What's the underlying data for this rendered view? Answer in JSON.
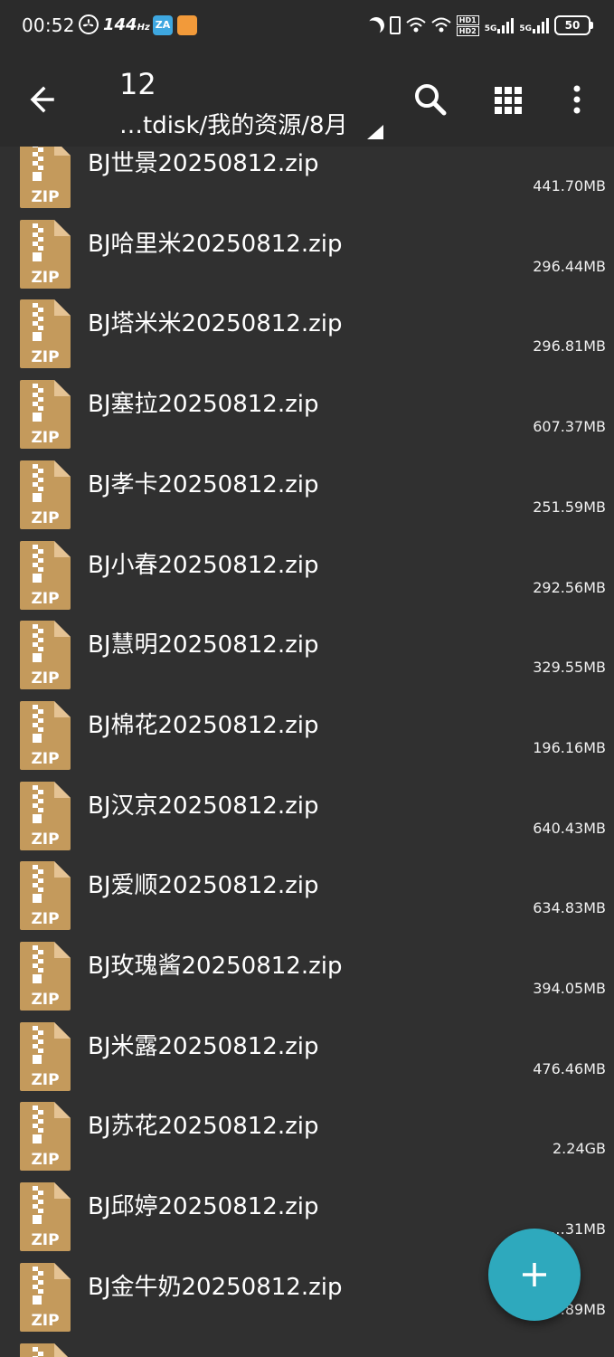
{
  "status_bar": {
    "time": "00:52",
    "refresh_rate": "144",
    "refresh_unit": "Hz",
    "app_badge": "ZA",
    "network_5g_1": "5G",
    "network_5g_2": "5G",
    "hd_label_1": "HD1",
    "hd_label_2": "HD2",
    "battery": "50"
  },
  "toolbar": {
    "title": "12",
    "path": "…tdisk/我的资源/8月"
  },
  "files": [
    {
      "name": "BJ世景20250812.zip",
      "size": "441.70MB"
    },
    {
      "name": "BJ哈里米20250812.zip",
      "size": "296.44MB"
    },
    {
      "name": "BJ塔米米20250812.zip",
      "size": "296.81MB"
    },
    {
      "name": "BJ塞拉20250812.zip",
      "size": "607.37MB"
    },
    {
      "name": "BJ孝卡20250812.zip",
      "size": "251.59MB"
    },
    {
      "name": "BJ小春20250812.zip",
      "size": "292.56MB"
    },
    {
      "name": "BJ慧明20250812.zip",
      "size": "329.55MB"
    },
    {
      "name": "BJ棉花20250812.zip",
      "size": "196.16MB"
    },
    {
      "name": "BJ汉京20250812.zip",
      "size": "640.43MB"
    },
    {
      "name": "BJ爱顺20250812.zip",
      "size": "634.83MB"
    },
    {
      "name": "BJ玫瑰酱20250812.zip",
      "size": "394.05MB"
    },
    {
      "name": "BJ米露20250812.zip",
      "size": "476.46MB"
    },
    {
      "name": "BJ苏花20250812.zip",
      "size": "2.24GB"
    },
    {
      "name": "BJ邱婷20250812.zip",
      "size": "…31MB"
    },
    {
      "name": "BJ金牛奶20250812.zip",
      "size": "606.89MB"
    },
    {
      "name": "",
      "size": ""
    }
  ],
  "icon_label": "ZIP",
  "colors": {
    "background": "#303030",
    "toolbar": "#2b2b2b",
    "zip_icon": "#c49a5c",
    "fab": "#2ea9bd"
  },
  "icons": {
    "back": "arrow-left-icon",
    "search": "search-icon",
    "grid": "grid-view-icon",
    "more": "more-vert-icon",
    "fab": "plus-icon"
  }
}
